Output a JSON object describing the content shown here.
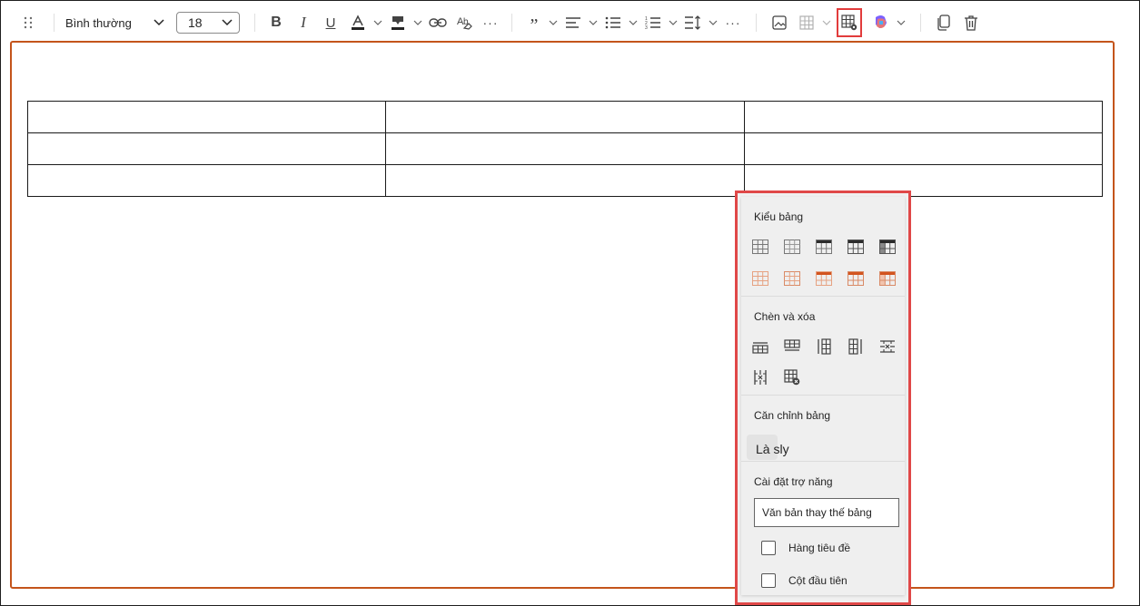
{
  "toolbar": {
    "style_value": "Bình thường",
    "font_size": "18",
    "icons": [
      "drag-handle",
      "bold",
      "italic",
      "underline",
      "font-color",
      "highlight",
      "link",
      "clear-format",
      "more",
      "quote",
      "align",
      "bullets",
      "numbering",
      "line-spacing",
      "more",
      "image",
      "table",
      "table-properties",
      "copilot",
      "copy",
      "delete"
    ]
  },
  "document": {
    "table_rows": 3,
    "table_cols": 3
  },
  "panel": {
    "table_style_title": "Kiểu bảng",
    "insert_delete_title": "Chèn và xóa",
    "alignment_title": "Căn chỉnh bảng",
    "alignment_value": "Là sly",
    "accessibility_title": "Cài đặt trợ năng",
    "alt_text_placeholder": "Văn bản thay thế bảng",
    "header_row_label": "Hàng tiêu đề",
    "first_column_label": "Cột đầu tiên",
    "style_colors": {
      "gray": "#777777",
      "dark": "#2b2b2b",
      "orange": "#d26a3a",
      "orange_light": "#f1c4ae"
    }
  }
}
